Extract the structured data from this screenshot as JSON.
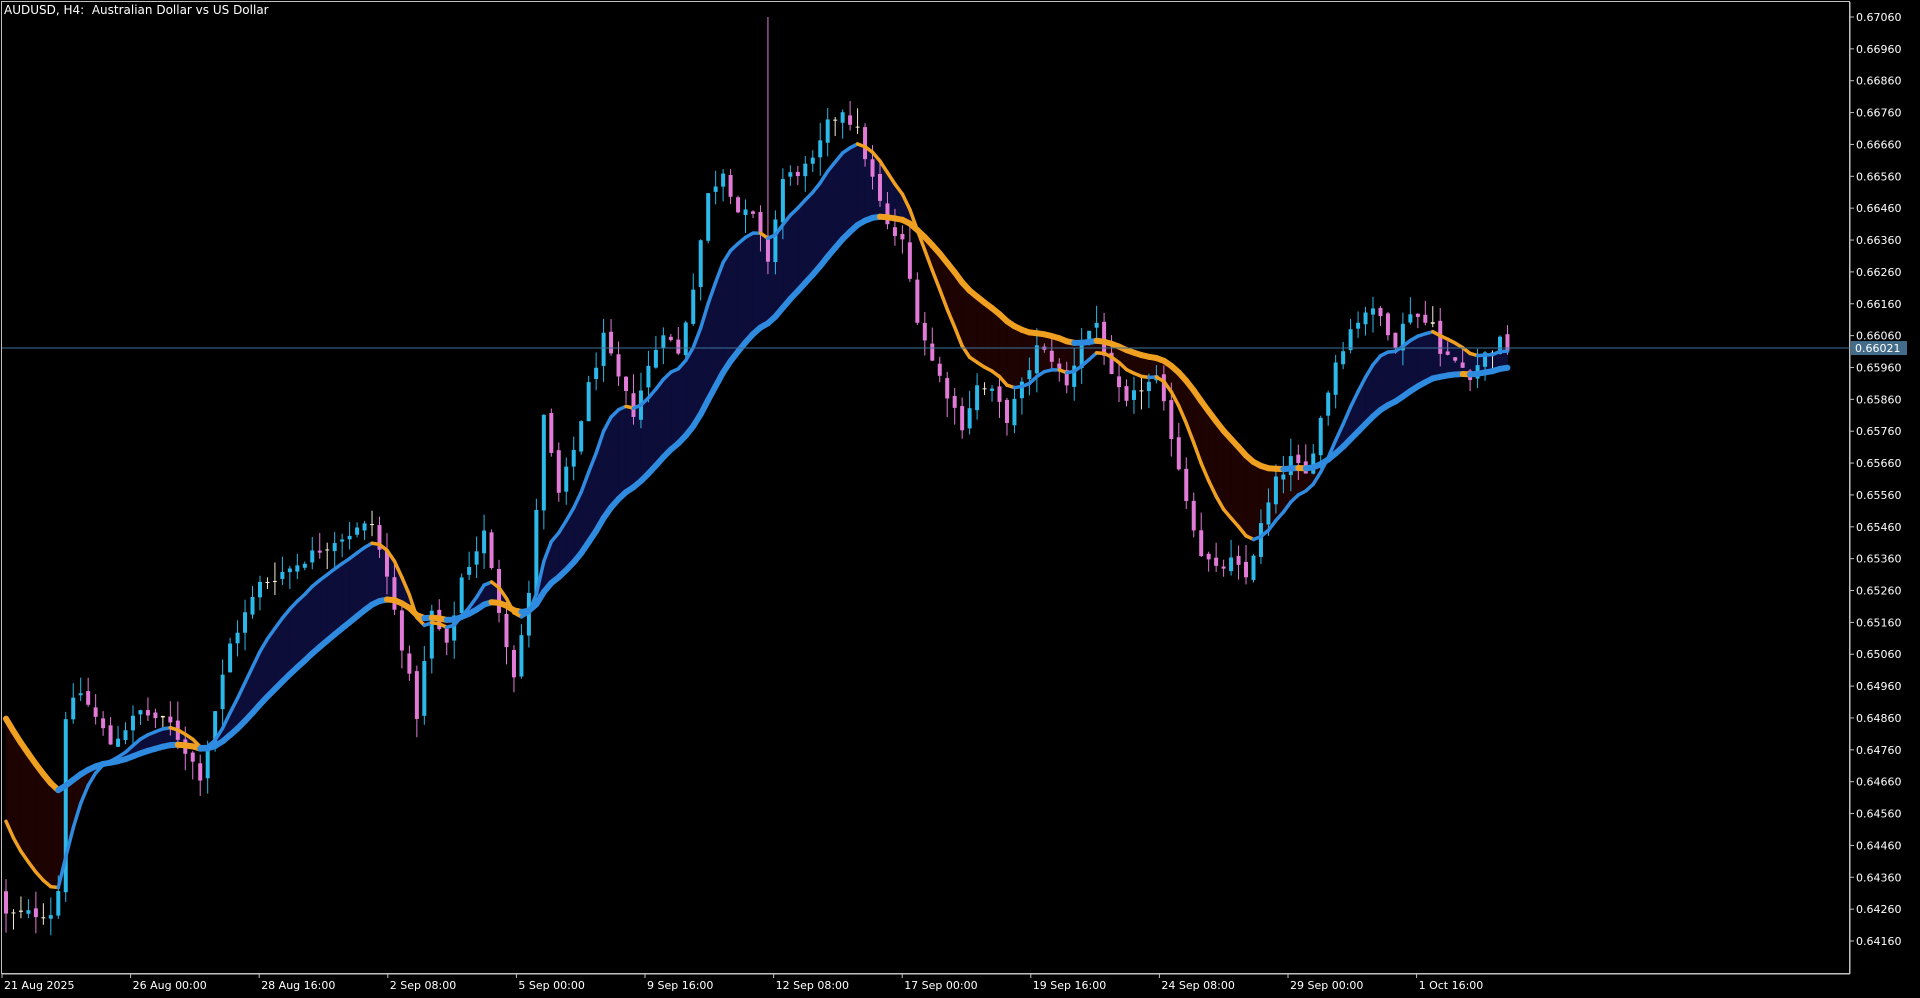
{
  "window": {
    "title": "AUDUSD, H4:  Australian Dollar vs US Dollar"
  },
  "colors": {
    "background": "#000000",
    "frame": "#c0c0c0",
    "text": "#ffffff",
    "bull_candle": "#2cb8e8",
    "bear_candle": "#e27ad8",
    "doji_candle": "#f5ecd8",
    "fast_line_down": "#f0a020",
    "slow_line": "#2e8be0",
    "fill_bull": "#0d0d3a",
    "fill_bear": "#1e0303",
    "price_line": "#3d7399",
    "price_label_bg": "#426c89"
  },
  "current_price": {
    "label": "0.66021",
    "value": 0.66021
  },
  "chart_data": {
    "type": "candlestick",
    "symbol": "AUDUSD",
    "timeframe": "H4",
    "title": "AUDUSD, H4:  Australian Dollar vs US Dollar",
    "ylim": [
      0.6408,
      0.6711
    ],
    "y_ticks": [
      "0.67060",
      "0.66960",
      "0.66860",
      "0.66760",
      "0.66660",
      "0.66560",
      "0.66460",
      "0.66360",
      "0.66260",
      "0.66160",
      "0.66060",
      "0.65960",
      "0.65860",
      "0.65760",
      "0.65660",
      "0.65560",
      "0.65460",
      "0.65360",
      "0.65260",
      "0.65160",
      "0.65060",
      "0.64960",
      "0.64860",
      "0.64760",
      "0.64660",
      "0.64560",
      "0.64460",
      "0.64360",
      "0.64260",
      "0.64160"
    ],
    "x_ticks": [
      "21 Aug 2025",
      "26 Aug 00:00",
      "28 Aug 16:00",
      "2 Sep 08:00",
      "5 Sep 00:00",
      "9 Sep 16:00",
      "12 Sep 08:00",
      "17 Sep 00:00",
      "19 Sep 16:00",
      "24 Sep 08:00",
      "29 Sep 00:00",
      "1 Oct 16:00"
    ],
    "close_path": [
      [
        0,
        0.6424
      ],
      [
        6,
        0.6425
      ],
      [
        7,
        0.6432
      ],
      [
        8,
        0.6487
      ],
      [
        10,
        0.6494
      ],
      [
        14,
        0.6478
      ],
      [
        18,
        0.6488
      ],
      [
        22,
        0.6484
      ],
      [
        26,
        0.6468
      ],
      [
        30,
        0.6509
      ],
      [
        34,
        0.6528
      ],
      [
        38,
        0.6533
      ],
      [
        44,
        0.6542
      ],
      [
        49,
        0.6547
      ],
      [
        51,
        0.653
      ],
      [
        53,
        0.6509
      ],
      [
        55,
        0.6487
      ],
      [
        57,
        0.6519
      ],
      [
        59,
        0.6508
      ],
      [
        61,
        0.653
      ],
      [
        63,
        0.6539
      ],
      [
        64,
        0.6544
      ],
      [
        66,
        0.652
      ],
      [
        68,
        0.65
      ],
      [
        70,
        0.6524
      ],
      [
        72,
        0.658
      ],
      [
        74,
        0.6556
      ],
      [
        76,
        0.657
      ],
      [
        78,
        0.659
      ],
      [
        80,
        0.6605
      ],
      [
        82,
        0.6592
      ],
      [
        84,
        0.6582
      ],
      [
        86,
        0.6596
      ],
      [
        88,
        0.6608
      ],
      [
        90,
        0.66
      ],
      [
        92,
        0.6622
      ],
      [
        94,
        0.665
      ],
      [
        96,
        0.6658
      ],
      [
        98,
        0.6645
      ],
      [
        100,
        0.6643
      ],
      [
        102,
        0.663
      ],
      [
        104,
        0.6655
      ],
      [
        108,
        0.666
      ],
      [
        110,
        0.6672
      ],
      [
        112,
        0.6677
      ],
      [
        114,
        0.667
      ],
      [
        116,
        0.6655
      ],
      [
        118,
        0.664
      ],
      [
        120,
        0.6635
      ],
      [
        122,
        0.6612
      ],
      [
        124,
        0.6598
      ],
      [
        126,
        0.6588
      ],
      [
        128,
        0.6578
      ],
      [
        130,
        0.659
      ],
      [
        132,
        0.6588
      ],
      [
        134,
        0.658
      ],
      [
        136,
        0.659
      ],
      [
        138,
        0.6602
      ],
      [
        140,
        0.6599
      ],
      [
        142,
        0.659
      ],
      [
        144,
        0.6605
      ],
      [
        146,
        0.661
      ],
      [
        148,
        0.6592
      ],
      [
        150,
        0.6584
      ],
      [
        152,
        0.659
      ],
      [
        154,
        0.6592
      ],
      [
        156,
        0.6575
      ],
      [
        158,
        0.6555
      ],
      [
        160,
        0.6538
      ],
      [
        162,
        0.6532
      ],
      [
        164,
        0.6535
      ],
      [
        166,
        0.653
      ],
      [
        168,
        0.6546
      ],
      [
        170,
        0.656
      ],
      [
        172,
        0.6567
      ],
      [
        174,
        0.6562
      ],
      [
        176,
        0.658
      ],
      [
        178,
        0.6598
      ],
      [
        180,
        0.6608
      ],
      [
        182,
        0.6614
      ],
      [
        184,
        0.6612
      ],
      [
        186,
        0.6604
      ],
      [
        188,
        0.6614
      ],
      [
        190,
        0.661
      ],
      [
        191,
        0.6612
      ],
      [
        192,
        0.66
      ],
      [
        194,
        0.6598
      ],
      [
        196,
        0.6594
      ],
      [
        198,
        0.66
      ],
      [
        200,
        0.6604
      ],
      [
        201,
        0.6602
      ]
    ],
    "moving_averages": [
      {
        "role": "fast",
        "period": 10
      },
      {
        "role": "slow",
        "period": 30
      }
    ]
  }
}
